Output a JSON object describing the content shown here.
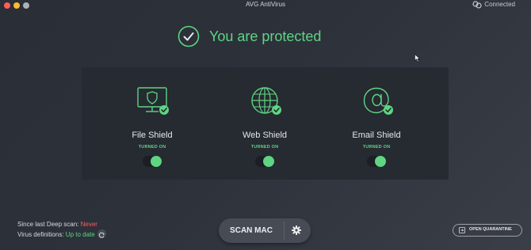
{
  "window": {
    "title": "AVG AntiVirus",
    "connection_status": "Connected"
  },
  "status": {
    "text": "You are protected"
  },
  "shields": [
    {
      "name": "File Shield",
      "state": "TURNED ON",
      "enabled": true,
      "icon": "monitor-shield-icon"
    },
    {
      "name": "Web Shield",
      "state": "TURNED ON",
      "enabled": true,
      "icon": "globe-icon"
    },
    {
      "name": "Email Shield",
      "state": "TURNED ON",
      "enabled": true,
      "icon": "at-sign-icon"
    }
  ],
  "scan_info": {
    "deep_scan_label": "Since last Deep scan:",
    "deep_scan_value": "Never",
    "definitions_label": "Virus definitions:",
    "definitions_value": "Up to date"
  },
  "actions": {
    "scan_label": "SCAN MAC",
    "quarantine_label": "OPEN QUARANTINE"
  },
  "colors": {
    "accent": "#5ed583",
    "warning": "#ff5a63",
    "background": "#2c3038",
    "panel": "#262a31"
  }
}
